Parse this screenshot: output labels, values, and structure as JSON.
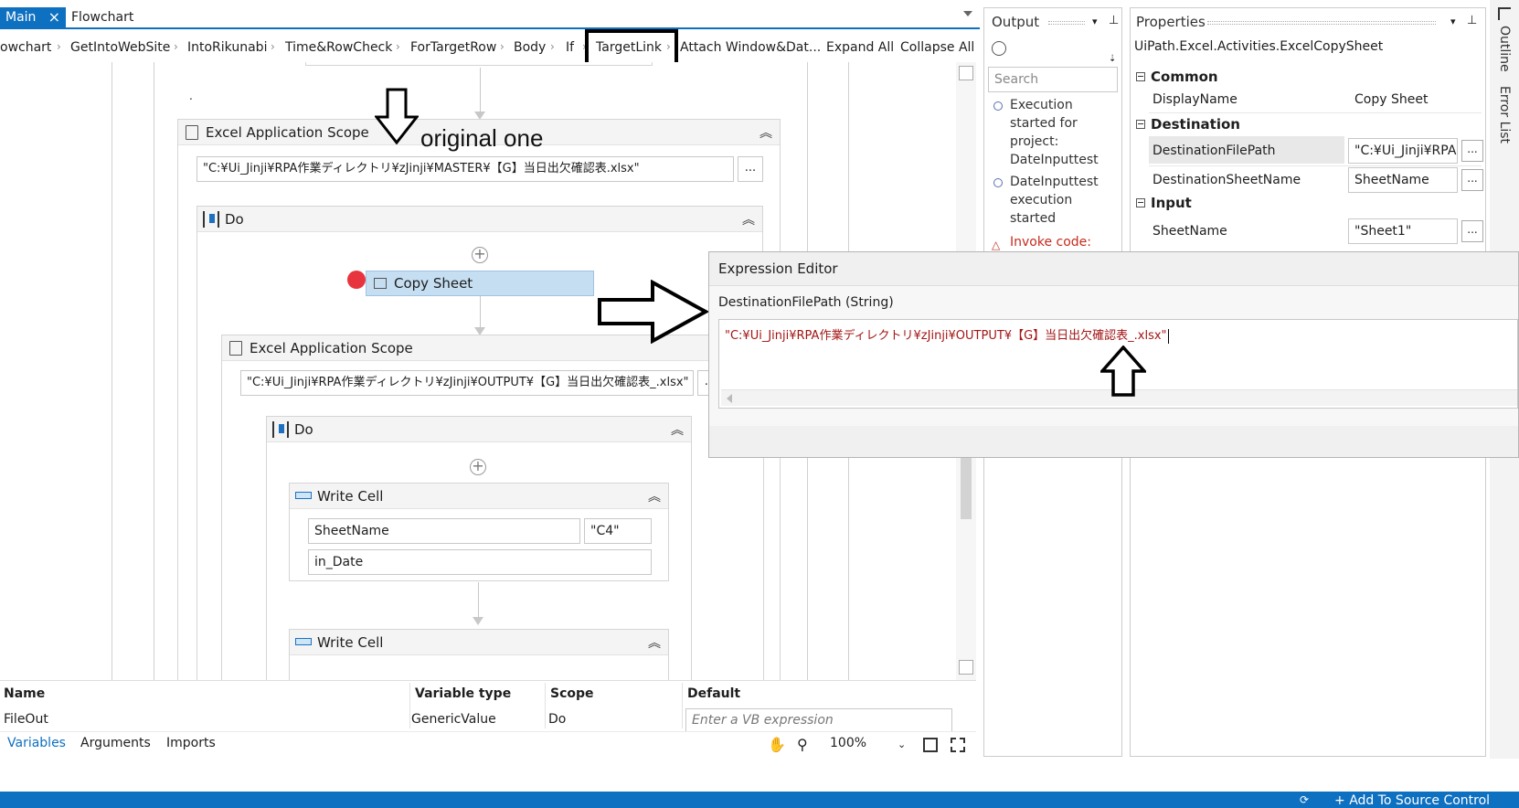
{
  "tabs": {
    "main": "Main",
    "flowchart": "Flowchart"
  },
  "breadcrumb": {
    "items": [
      "owchart",
      "GetIntoWebSite",
      "IntoRikunabi",
      "Time&RowCheck",
      "ForTargetRow",
      "Body",
      "If",
      "TargetLink",
      "Attach Window&Dat..."
    ],
    "expand_all": "Expand All",
    "collapse_all": "Collapse All"
  },
  "designer": {
    "scope1_title": "Excel Application Scope",
    "scope1_path": "\"C:¥Ui_Jinji¥RPA作業ディレクトリ¥zJinji¥MASTER¥【G】当日出欠確認表.xlsx\"",
    "do1_title": "Do",
    "copy_sheet": "Copy Sheet",
    "scope2_title": "Excel Application Scope",
    "scope2_path": "\"C:¥Ui_Jinji¥RPA作業ディレクトリ¥zJinji¥OUTPUT¥【G】当日出欠確認表_.xlsx\"",
    "do2_title": "Do",
    "write_cell1_title": "Write Cell",
    "write_cell1_sheet": "SheetName",
    "write_cell1_range": "\"C4\"",
    "write_cell1_value": "in_Date",
    "write_cell2_title": "Write Cell",
    "dots": "...",
    "dot_mark": "."
  },
  "annotation": {
    "original_one": "original one"
  },
  "variables": {
    "headers": {
      "name": "Name",
      "type": "Variable type",
      "scope": "Scope",
      "default": "Default"
    },
    "row": {
      "name": "FileOut",
      "type": "GenericValue",
      "scope": "Do",
      "default_placeholder": "Enter a VB expression"
    },
    "tabs": [
      "Variables",
      "Arguments",
      "Imports"
    ],
    "zoom": "100%"
  },
  "output": {
    "title": "Output",
    "search_placeholder": "Search",
    "lines": [
      "Execution started for project: DateInputtest",
      "DateInputtest execution started",
      "Invoke code:"
    ]
  },
  "properties": {
    "title": "Properties",
    "activity_type": "UiPath.Excel.Activities.ExcelCopySheet",
    "categories": {
      "common": "Common",
      "destination": "Destination",
      "input": "Input"
    },
    "rows": {
      "display_name_label": "DisplayName",
      "display_name_value": "Copy Sheet",
      "dest_path_label": "DestinationFilePath",
      "dest_path_value": "\"C:¥Ui_Jinji¥RPA",
      "dest_sheet_label": "DestinationSheetName",
      "dest_sheet_value": "SheetName",
      "sheet_name_label": "SheetName",
      "sheet_name_value": "\"Sheet1\""
    },
    "dots": "..."
  },
  "side_tabs": [
    "Outline",
    "Error List"
  ],
  "expression_editor": {
    "title": "Expression Editor",
    "subtitle": "DestinationFilePath (String)",
    "value": "\"C:¥Ui_Jinji¥RPA作業ディレクトリ¥zJinji¥OUTPUT¥【G】当日出欠確認表_.xlsx\""
  },
  "status_bar": {
    "source_control": "Add To Source Control"
  },
  "colors": {
    "accent": "#0e70c0",
    "string_literal": "#a31515",
    "error": "#c42b1c",
    "selected_activity": "#c5def1",
    "breakpoint": "#e8343e"
  }
}
